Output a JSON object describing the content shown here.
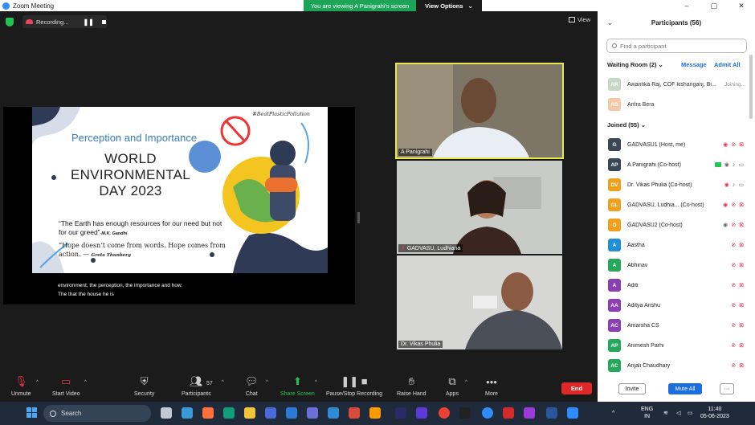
{
  "window": {
    "title": "Zoom Meeting",
    "viewing_banner": "You are viewing A Panigrahi's screen",
    "view_options": "View Options",
    "controls": [
      "–",
      "▢",
      "✕"
    ]
  },
  "recording": {
    "label": "Recording...",
    "pause_glyph": "❚❚"
  },
  "view_button": "View",
  "slide": {
    "hashtag": "#BeatPlasticPollution",
    "subtitle": "Perception and Importance",
    "title_line1": "WORLD",
    "title_line2": "ENVIRONMENTAL",
    "title_line3": "DAY 2023",
    "quote1": "“The Earth has enough resources for our need but not for our greed”",
    "quote1_author": "-M.K. Gandhi",
    "quote2": "“Hope doesn’t come from words. Hope comes from action. —",
    "quote2_author": "Greta Thunberg"
  },
  "captions": {
    "line1": "environment, the perception, the importance and how.",
    "line2": "The that the house he is"
  },
  "videos": [
    {
      "name": "A Panigrahi"
    },
    {
      "name": "GADVASU, Ludhiana"
    },
    {
      "name": "Dr. Vikas Phulia"
    }
  ],
  "toolbar": {
    "unmute": "Unmute",
    "start_video": "Start Video",
    "security": "Security",
    "participants": "Participants",
    "participants_count": "57",
    "chat": "Chat",
    "share_screen": "Share Screen",
    "pause_recording": "Pause/Stop Recording",
    "raise_hand": "Raise Hand",
    "apps": "Apps",
    "more": "More",
    "end": "End"
  },
  "panel": {
    "title": "Participants (56)",
    "search_placeholder": "Find a participant",
    "waiting_room": "Waiting Room (2)",
    "message": "Message",
    "admit_all": "Admit All",
    "waiting": [
      {
        "initials": "AR",
        "name": "Awantika Raj, COF kishanganj, Bi...",
        "status": "Joining...",
        "color": "#c9d7c9"
      },
      {
        "initials": "AB",
        "name": "Aritra Bera",
        "status": "",
        "color": "#f6c8a6"
      }
    ],
    "joined_label": "Joined (55)",
    "joined": [
      {
        "initials": "G",
        "name": "GADVASU1 (Host, me)",
        "color": "#3a4656"
      },
      {
        "initials": "AP",
        "name": "A Panigrahi (Co-host)",
        "color": "#3a4656"
      },
      {
        "initials": "DV",
        "name": "Dr. Vikas Phulia (Co-host)",
        "color": "#f0a01c"
      },
      {
        "initials": "GL",
        "name": "GADVASU, Ludhia... (Co-host)",
        "color": "#f0a01c"
      },
      {
        "initials": "G",
        "name": "GADVASU2 (Co-host)",
        "color": "#f0a01c"
      },
      {
        "initials": "A",
        "name": "Aastha",
        "color": "#1f8fd9"
      },
      {
        "initials": "A",
        "name": "Abhinav",
        "color": "#25a85a"
      },
      {
        "initials": "A",
        "name": "Aditi",
        "color": "#8c3fb3"
      },
      {
        "initials": "AA",
        "name": "Aditya Anshu",
        "color": "#8c3fb3"
      },
      {
        "initials": "AC",
        "name": "Amarsha CS",
        "color": "#8c3fb3"
      },
      {
        "initials": "AP",
        "name": "Animesh Parhi",
        "color": "#25a85a"
      },
      {
        "initials": "AC",
        "name": "Anjali Chaudhary",
        "color": "#25a85a"
      }
    ],
    "invite": "Invite",
    "mute_all": "Mute All",
    "more": "···"
  },
  "taskbar": {
    "search": "Search",
    "lang_line1": "ENG",
    "lang_line2": "IN",
    "time": "11:40",
    "date": "05-06-2023"
  },
  "colors": {
    "accent": "#2d8cff",
    "end": "#e02828",
    "banner": "#1ea456",
    "highlight": "#e8e84a"
  }
}
